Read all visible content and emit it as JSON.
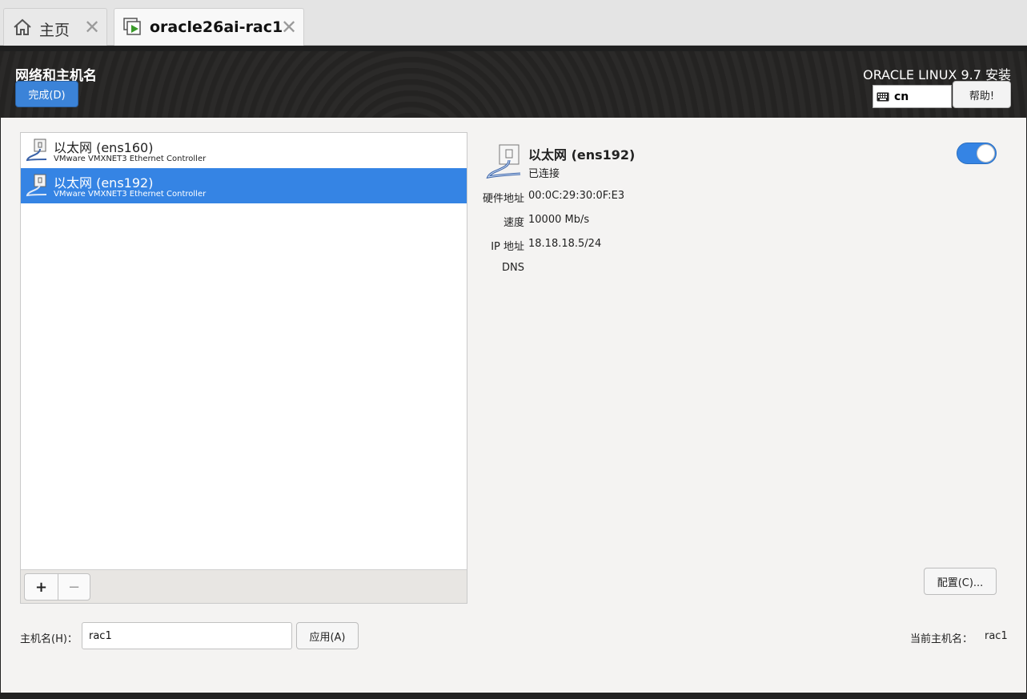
{
  "tabs": [
    {
      "label": "主页",
      "icon": "home-icon"
    },
    {
      "label": "oracle26ai-rac1",
      "icon": "vm-running-icon"
    }
  ],
  "header": {
    "title": "网络和主机名",
    "done_label": "完成(D)",
    "product": "ORACLE LINUX 9.7 安装",
    "keyboard_layout": "cn",
    "help_label": "帮助!"
  },
  "networks": [
    {
      "name": "以太网 (ens160)",
      "description": "VMware VMXNET3 Ethernet Controller",
      "selected": false
    },
    {
      "name": "以太网 (ens192)",
      "description": "VMware VMXNET3 Ethernet Controller",
      "selected": true
    }
  ],
  "list_controls": {
    "add": "+",
    "remove": "−"
  },
  "detail": {
    "name": "以太网 (ens192)",
    "status": "已连接",
    "enabled": true,
    "properties": [
      {
        "label": "硬件地址",
        "value": "00:0C:29:30:0F:E3"
      },
      {
        "label": "速度",
        "value": "10000 Mb/s"
      },
      {
        "label": "IP 地址",
        "value": "18.18.18.5/24"
      },
      {
        "label": "DNS",
        "value": ""
      }
    ],
    "configure_label": "配置(C)..."
  },
  "hostname": {
    "label": "主机名(H)：",
    "value": "rac1",
    "apply_label": "应用(A)",
    "current_label": "当前主机名：",
    "current_value": "rac1"
  },
  "colors": {
    "accent": "#3584e4",
    "header_bg": "#2b2a29",
    "content_bg": "#f4f3f2"
  }
}
